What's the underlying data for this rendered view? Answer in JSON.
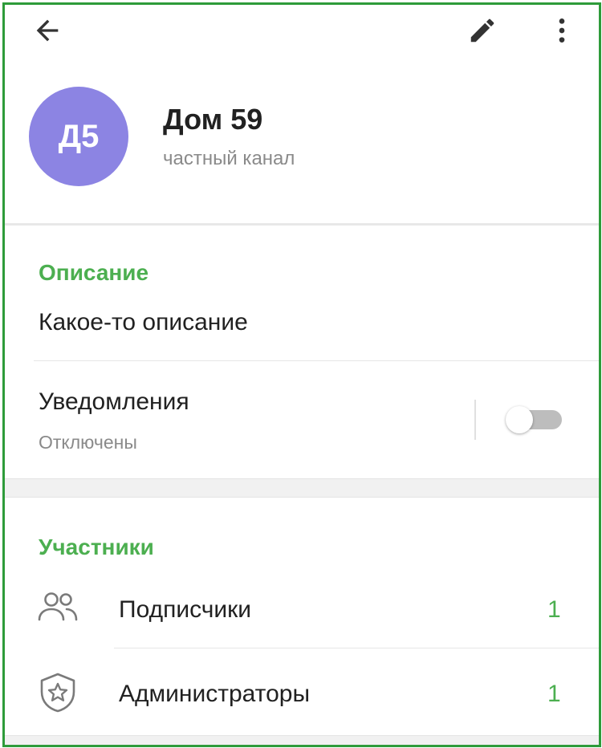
{
  "header": {
    "avatar_initials": "Д5",
    "title": "Дом 59",
    "subtitle": "частный канал",
    "avatar_color": "#8c84e3"
  },
  "toolbar": {
    "back_icon": "arrow-back-icon",
    "edit_icon": "pencil-icon",
    "more_icon": "more-vert-icon"
  },
  "description": {
    "section_title": "Описание",
    "text": "Какое-то описание"
  },
  "notifications": {
    "label": "Уведомления",
    "status": "Отключены",
    "enabled": false
  },
  "members": {
    "section_title": "Участники",
    "items": [
      {
        "label": "Подписчики",
        "count": "1",
        "icon": "people-icon"
      },
      {
        "label": "Администраторы",
        "count": "1",
        "icon": "shield-star-icon"
      }
    ]
  },
  "colors": {
    "accent": "#4caf50",
    "frame": "#2e9b3a"
  }
}
